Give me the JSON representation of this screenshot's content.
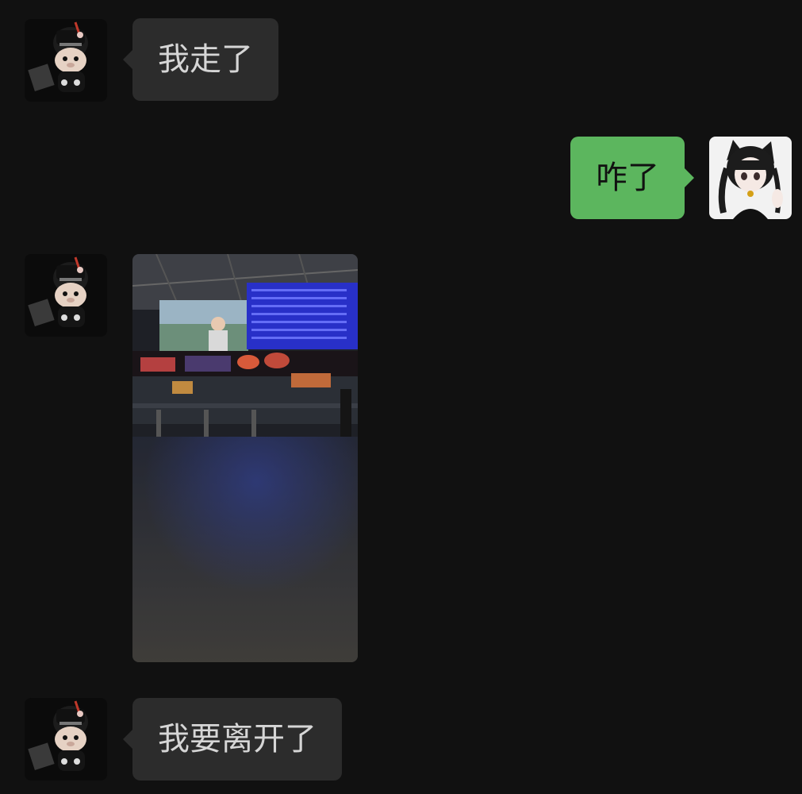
{
  "messages": [
    {
      "id": "m1",
      "sender": "contact",
      "type": "text",
      "text": "我走了"
    },
    {
      "id": "m2",
      "sender": "me",
      "type": "text",
      "text": "咋了"
    },
    {
      "id": "m3",
      "sender": "contact",
      "type": "image",
      "image": "train-station-hall-photo"
    },
    {
      "id": "m4",
      "sender": "contact",
      "type": "text",
      "text": "我要离开了"
    }
  ],
  "avatars": {
    "contact": "plush-bear-in-hat-avatar",
    "me": "anime-cat-ear-girl-avatar"
  },
  "colors": {
    "background": "#111111",
    "incoming_bubble": "#2c2c2c",
    "incoming_text": "#d6d6d6",
    "outgoing_bubble": "#5cb65e",
    "outgoing_text": "#111111"
  }
}
